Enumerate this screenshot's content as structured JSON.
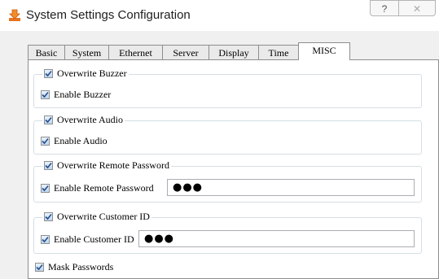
{
  "window": {
    "title": "System Settings Configuration",
    "help_label": "?",
    "close_label": "✕"
  },
  "tabs": [
    {
      "label": "Basic"
    },
    {
      "label": "System"
    },
    {
      "label": "Ethernet"
    },
    {
      "label": "Server"
    },
    {
      "label": "Display"
    },
    {
      "label": "Time"
    },
    {
      "label": "MISC",
      "active": true
    }
  ],
  "misc": {
    "buzzer": {
      "overwrite_label": "Overwrite Buzzer",
      "overwrite_checked": true,
      "enable_label": "Enable Buzzer",
      "enable_checked": true
    },
    "audio": {
      "overwrite_label": "Overwrite Audio",
      "overwrite_checked": true,
      "enable_label": "Enable Audio",
      "enable_checked": true
    },
    "remote_password": {
      "overwrite_label": "Overwrite Remote Password",
      "overwrite_checked": true,
      "enable_label": "Enable Remote Password",
      "enable_checked": true,
      "value": "●●●"
    },
    "customer_id": {
      "overwrite_label": "Overwrite Customer ID",
      "overwrite_checked": true,
      "enable_label": "Enable Customer ID",
      "enable_checked": true,
      "value": "●●●"
    },
    "mask_passwords": {
      "label": "Mask Passwords",
      "checked": true
    }
  },
  "icons": {
    "app": "download-arrow-icon",
    "help": "question-icon",
    "close": "close-icon",
    "check": "checkmark-icon"
  }
}
